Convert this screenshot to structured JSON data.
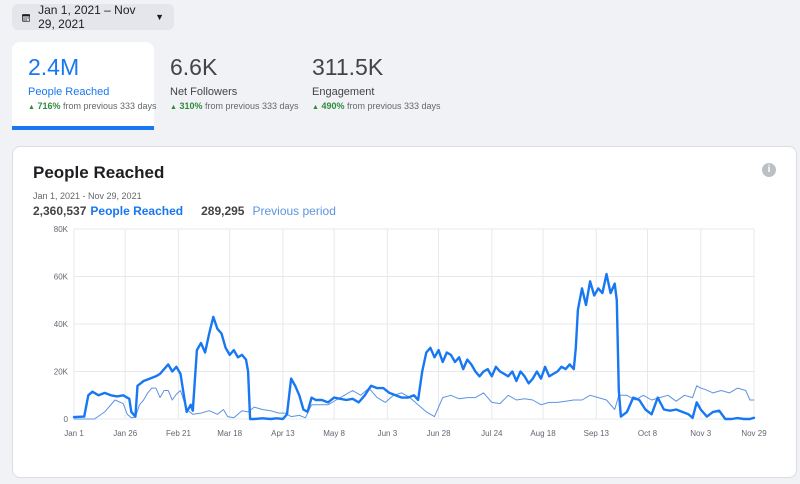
{
  "date_range": {
    "label": "Jan 1, 2021 – Nov 29, 2021"
  },
  "tabs": [
    {
      "value": "2.4M",
      "label": "People Reached",
      "pct": "716%",
      "suffix": "from previous 333 days"
    },
    {
      "value": "6.6K",
      "label": "Net Followers",
      "pct": "310%",
      "suffix": "from previous 333 days"
    },
    {
      "value": "311.5K",
      "label": "Engagement",
      "pct": "490%",
      "suffix": "from previous 333 days"
    }
  ],
  "card": {
    "title": "People Reached",
    "range": "Jan 1, 2021 - Nov 29, 2021",
    "current_total": "2,360,537",
    "current_label": "People Reached",
    "previous_total": "289,295",
    "previous_label": "Previous period",
    "info_icon": "i"
  },
  "chart_data": {
    "type": "line",
    "ylim": [
      0,
      80000
    ],
    "y_ticks": [
      "0",
      "20K",
      "40K",
      "60K",
      "80K"
    ],
    "x_ticks": [
      "Jan 1",
      "Jan 26",
      "Feb 21",
      "Mar 18",
      "Apr 13",
      "May 8",
      "Jun 3",
      "Jun 28",
      "Jul 24",
      "Aug 18",
      "Sep 13",
      "Oct 8",
      "Nov 3",
      "Nov 29"
    ],
    "x_tick_days": [
      0,
      25,
      51,
      76,
      102,
      127,
      153,
      178,
      204,
      229,
      255,
      280,
      306,
      332
    ],
    "series": [
      {
        "name": "People Reached",
        "color": "#1877f2",
        "points": [
          [
            0,
            800
          ],
          [
            5,
            1000
          ],
          [
            7,
            10000
          ],
          [
            9,
            11500
          ],
          [
            12,
            10000
          ],
          [
            15,
            11000
          ],
          [
            18,
            10000
          ],
          [
            21,
            9500
          ],
          [
            24,
            10000
          ],
          [
            27,
            8500
          ],
          [
            28,
            3000
          ],
          [
            30,
            1000
          ],
          [
            31,
            14000
          ],
          [
            34,
            16000
          ],
          [
            37,
            17000
          ],
          [
            40,
            18000
          ],
          [
            42,
            19000
          ],
          [
            44,
            21000
          ],
          [
            46,
            23000
          ],
          [
            48,
            20000
          ],
          [
            50,
            22000
          ],
          [
            52,
            19000
          ],
          [
            54,
            8000
          ],
          [
            55,
            3000
          ],
          [
            57,
            6000
          ],
          [
            58,
            3500
          ],
          [
            60,
            29000
          ],
          [
            62,
            32000
          ],
          [
            64,
            28000
          ],
          [
            66,
            36000
          ],
          [
            68,
            43000
          ],
          [
            70,
            38000
          ],
          [
            72,
            36000
          ],
          [
            74,
            30000
          ],
          [
            76,
            27000
          ],
          [
            78,
            29000
          ],
          [
            80,
            26000
          ],
          [
            82,
            27000
          ],
          [
            84,
            25000
          ],
          [
            85,
            20000
          ],
          [
            86,
            0
          ],
          [
            88,
            0
          ],
          [
            92,
            300
          ],
          [
            96,
            0
          ],
          [
            99,
            300
          ],
          [
            102,
            0
          ],
          [
            104,
            2000
          ],
          [
            106,
            17000
          ],
          [
            108,
            14000
          ],
          [
            110,
            10000
          ],
          [
            112,
            4000
          ],
          [
            114,
            3000
          ],
          [
            116,
            9000
          ],
          [
            118,
            8000
          ],
          [
            121,
            8000
          ],
          [
            124,
            7000
          ],
          [
            127,
            9000
          ],
          [
            130,
            8500
          ],
          [
            133,
            8000
          ],
          [
            136,
            8500
          ],
          [
            139,
            7000
          ],
          [
            142,
            10000
          ],
          [
            145,
            14000
          ],
          [
            148,
            13000
          ],
          [
            151,
            13000
          ],
          [
            154,
            11000
          ],
          [
            157,
            10000
          ],
          [
            160,
            9000
          ],
          [
            163,
            9000
          ],
          [
            166,
            10000
          ],
          [
            168,
            8000
          ],
          [
            170,
            20000
          ],
          [
            172,
            28000
          ],
          [
            174,
            30000
          ],
          [
            176,
            26000
          ],
          [
            178,
            29000
          ],
          [
            180,
            24000
          ],
          [
            182,
            28000
          ],
          [
            184,
            27000
          ],
          [
            186,
            24000
          ],
          [
            188,
            26000
          ],
          [
            190,
            21000
          ],
          [
            192,
            25000
          ],
          [
            194,
            23000
          ],
          [
            196,
            20000
          ],
          [
            198,
            18000
          ],
          [
            200,
            20000
          ],
          [
            202,
            21000
          ],
          [
            204,
            18000
          ],
          [
            206,
            22000
          ],
          [
            208,
            20000
          ],
          [
            210,
            19000
          ],
          [
            212,
            18000
          ],
          [
            214,
            20000
          ],
          [
            216,
            16000
          ],
          [
            218,
            20000
          ],
          [
            220,
            18000
          ],
          [
            222,
            15000
          ],
          [
            224,
            17000
          ],
          [
            226,
            20000
          ],
          [
            228,
            17000
          ],
          [
            230,
            22000
          ],
          [
            232,
            18000
          ],
          [
            234,
            19000
          ],
          [
            236,
            20000
          ],
          [
            238,
            22000
          ],
          [
            240,
            21000
          ],
          [
            242,
            23000
          ],
          [
            244,
            21000
          ],
          [
            245,
            30000
          ],
          [
            246,
            46000
          ],
          [
            248,
            55000
          ],
          [
            250,
            48000
          ],
          [
            252,
            58000
          ],
          [
            254,
            52000
          ],
          [
            256,
            55000
          ],
          [
            258,
            53000
          ],
          [
            260,
            61000
          ],
          [
            262,
            53000
          ],
          [
            264,
            57000
          ],
          [
            265,
            50000
          ],
          [
            266,
            12000
          ],
          [
            267,
            1000
          ],
          [
            270,
            3000
          ],
          [
            273,
            9000
          ],
          [
            276,
            8000
          ],
          [
            279,
            4000
          ],
          [
            282,
            2000
          ],
          [
            285,
            9000
          ],
          [
            288,
            4000
          ],
          [
            291,
            3500
          ],
          [
            294,
            4000
          ],
          [
            297,
            3000
          ],
          [
            300,
            2000
          ],
          [
            302,
            500
          ],
          [
            304,
            7000
          ],
          [
            306,
            4000
          ],
          [
            309,
            1000
          ],
          [
            312,
            3000
          ],
          [
            315,
            3500
          ],
          [
            318,
            0
          ],
          [
            321,
            0
          ],
          [
            324,
            400
          ],
          [
            327,
            0
          ],
          [
            330,
            0
          ],
          [
            332,
            500
          ]
        ]
      },
      {
        "name": "Previous period",
        "color": "#5b94e0",
        "points": [
          [
            0,
            0
          ],
          [
            10,
            0
          ],
          [
            15,
            3000
          ],
          [
            20,
            8000
          ],
          [
            24,
            6500
          ],
          [
            26,
            2000
          ],
          [
            28,
            500
          ],
          [
            30,
            800
          ],
          [
            32,
            6000
          ],
          [
            34,
            8000
          ],
          [
            36,
            11000
          ],
          [
            38,
            13000
          ],
          [
            40,
            13000
          ],
          [
            42,
            9000
          ],
          [
            44,
            12000
          ],
          [
            46,
            12000
          ],
          [
            48,
            8000
          ],
          [
            50,
            10500
          ],
          [
            52,
            12000
          ],
          [
            55,
            4000
          ],
          [
            58,
            2000
          ],
          [
            62,
            2500
          ],
          [
            66,
            3500
          ],
          [
            70,
            2000
          ],
          [
            73,
            4000
          ],
          [
            75,
            1000
          ],
          [
            78,
            500
          ],
          [
            82,
            3500
          ],
          [
            85,
            3000
          ],
          [
            88,
            5000
          ],
          [
            92,
            4000
          ],
          [
            96,
            3500
          ],
          [
            100,
            2500
          ],
          [
            103,
            2500
          ],
          [
            106,
            1000
          ],
          [
            110,
            1500
          ],
          [
            113,
            500
          ],
          [
            116,
            6000
          ],
          [
            120,
            6000
          ],
          [
            124,
            6000
          ],
          [
            128,
            8000
          ],
          [
            132,
            10000
          ],
          [
            136,
            12000
          ],
          [
            140,
            10000
          ],
          [
            144,
            13000
          ],
          [
            148,
            9000
          ],
          [
            152,
            7000
          ],
          [
            156,
            10000
          ],
          [
            160,
            11000
          ],
          [
            164,
            9000
          ],
          [
            168,
            6000
          ],
          [
            172,
            3000
          ],
          [
            176,
            1000
          ],
          [
            180,
            9000
          ],
          [
            184,
            10000
          ],
          [
            188,
            8500
          ],
          [
            192,
            9000
          ],
          [
            196,
            9000
          ],
          [
            200,
            11000
          ],
          [
            204,
            7000
          ],
          [
            208,
            6500
          ],
          [
            212,
            10000
          ],
          [
            216,
            8000
          ],
          [
            220,
            8500
          ],
          [
            224,
            8000
          ],
          [
            228,
            6000
          ],
          [
            232,
            7000
          ],
          [
            236,
            7000
          ],
          [
            240,
            7500
          ],
          [
            244,
            8000
          ],
          [
            248,
            8000
          ],
          [
            252,
            10000
          ],
          [
            256,
            9000
          ],
          [
            260,
            8000
          ],
          [
            264,
            4000
          ],
          [
            266,
            10000
          ],
          [
            270,
            10000
          ],
          [
            274,
            8000
          ],
          [
            278,
            10000
          ],
          [
            282,
            8000
          ],
          [
            286,
            9000
          ],
          [
            290,
            10000
          ],
          [
            294,
            7500
          ],
          [
            298,
            10000
          ],
          [
            302,
            9000
          ],
          [
            304,
            14000
          ],
          [
            306,
            13000
          ],
          [
            308,
            12500
          ],
          [
            312,
            11000
          ],
          [
            316,
            12000
          ],
          [
            320,
            11000
          ],
          [
            324,
            13000
          ],
          [
            328,
            12000
          ],
          [
            330,
            8000
          ],
          [
            332,
            8000
          ]
        ]
      }
    ]
  }
}
